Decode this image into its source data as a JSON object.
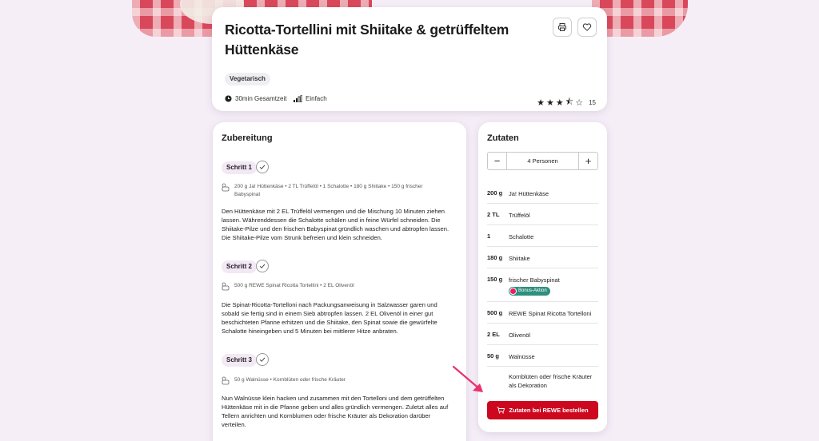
{
  "recipe": {
    "title": "Ricotta-Tortellini mit Shiitake & getrüffeltem Hüttenkäse",
    "tag": "Vegetarisch",
    "total_time": "30min Gesamtzeit",
    "difficulty": "Einfach",
    "rating_stars": 3.5,
    "rating_count": "15"
  },
  "preparation": {
    "heading": "Zubereitung",
    "steps": [
      {
        "label": "Schritt 1",
        "ingredients": "200 g Ja! Hüttenkäse  • 2 TL Trüffelöl  • 1 Schalotte  • 180 g Shiitake  • 150 g frischer Babyspinat",
        "text": "Den Hüttenkäse mit 2 EL Trüffelöl vermengen und die Mischung 10 Minuten ziehen lassen. Währenddessen die Schalotte schälen und in feine Würfel schneiden. Die Shiitake-Pilze und den frischen Babyspinat gründlich waschen und abtropfen lassen. Die Shiitake-Pilze vom Strunk befreien und klein schneiden."
      },
      {
        "label": "Schritt 2",
        "ingredients": "500 g REWE Spinat Ricotta Tortellini  • 2 EL Olivenöl",
        "text": "Die Spinat-Ricotta-Tortelloni nach Packungsanweisung in Salzwasser garen und sobald sie fertig sind in einem Sieb abtropfen lassen. 2 EL Olivenöl in einer gut beschichteten Pfanne erhitzen und die Shiitake, den Spinat sowie die gewürfelte Schalotte hineingeben und 5 Minuten bei mittlerer Hitze anbraten."
      },
      {
        "label": "Schritt 3",
        "ingredients": "50 g Walnüsse  • Kornblüten oder frische Kräuter",
        "text": "Nun Walnüsse klein hacken und zusammen mit den Tortelloni und dem getrüffelten Hüttenkäse mit in die Pfanne geben und alles gründlich vermengen. Zuletzt alles auf Tellern anrichten und Kornblumen oder frische Kräuter als Dekoration darüber verteilen."
      }
    ]
  },
  "ingredients_panel": {
    "heading": "Zutaten",
    "servings": "4 Personen",
    "items": [
      {
        "qty": "200 g",
        "name": "Ja! Hüttenkäse"
      },
      {
        "qty": "2 TL",
        "name": "Trüffelöl"
      },
      {
        "qty": "1",
        "name": "Schalotte"
      },
      {
        "qty": "180 g",
        "name": "Shiitake"
      },
      {
        "qty": "150 g",
        "name": "frischer Babyspinat",
        "badge": "Bonus-Aktion"
      },
      {
        "qty": "500 g",
        "name": "REWE Spinat Ricotta Tortelloni"
      },
      {
        "qty": "2 EL",
        "name": "Olivenöl"
      },
      {
        "qty": "50 g",
        "name": "Walnüsse"
      },
      {
        "qty": "",
        "name": "Kornblüten oder frische Kräuter als Dekoration"
      }
    ],
    "order_button": "Zutaten bei REWE bestellen"
  },
  "colors": {
    "accent_red": "#cc071e",
    "bonus_green": "#2e8f7e",
    "annotation_arrow": "#e8336d"
  },
  "icons": [
    "print-icon",
    "heart-icon",
    "clock-icon",
    "difficulty-icon",
    "star-icon",
    "check-icon",
    "ingredients-icon",
    "minus-icon",
    "plus-icon",
    "cart-icon"
  ]
}
